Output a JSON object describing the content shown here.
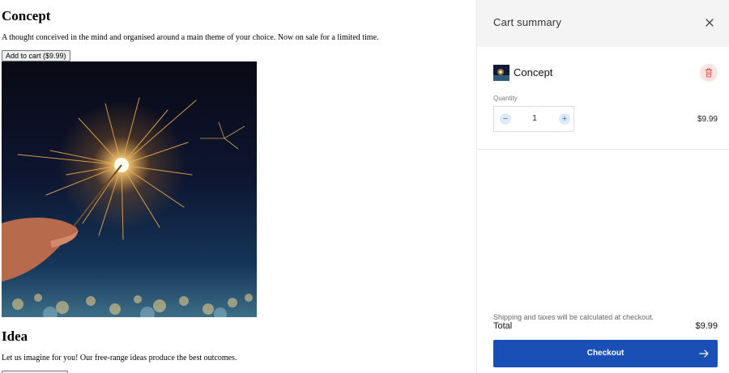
{
  "products": [
    {
      "title": "Concept",
      "description": "A thought conceived in the mind and organised around a main theme of your choice. Now on sale for a limited time.",
      "button_label": "Add to cart ($9.99)",
      "image_icon": "sparkler-photo"
    },
    {
      "title": "Idea",
      "description": "Let us imagine for you! Our free-range ideas produce the best outcomes.",
      "button_label": ""
    }
  ],
  "cart": {
    "title": "Cart summary",
    "close_icon": "close-icon",
    "item": {
      "name": "Concept",
      "quantity_label": "Quantity",
      "quantity": "1",
      "price": "$9.99",
      "remove_icon": "trash-icon"
    },
    "shipping_note": "Shipping and taxes will be calculated at checkout.",
    "total_label": "Total",
    "total_value": "$9.99",
    "checkout_label": "Checkout",
    "checkout_icon": "arrow-right-icon"
  },
  "colors": {
    "checkout_button": "#1a4fb5",
    "remove_button_bg": "#fbe3e1",
    "qty_button_bg": "#dfeaf8"
  }
}
